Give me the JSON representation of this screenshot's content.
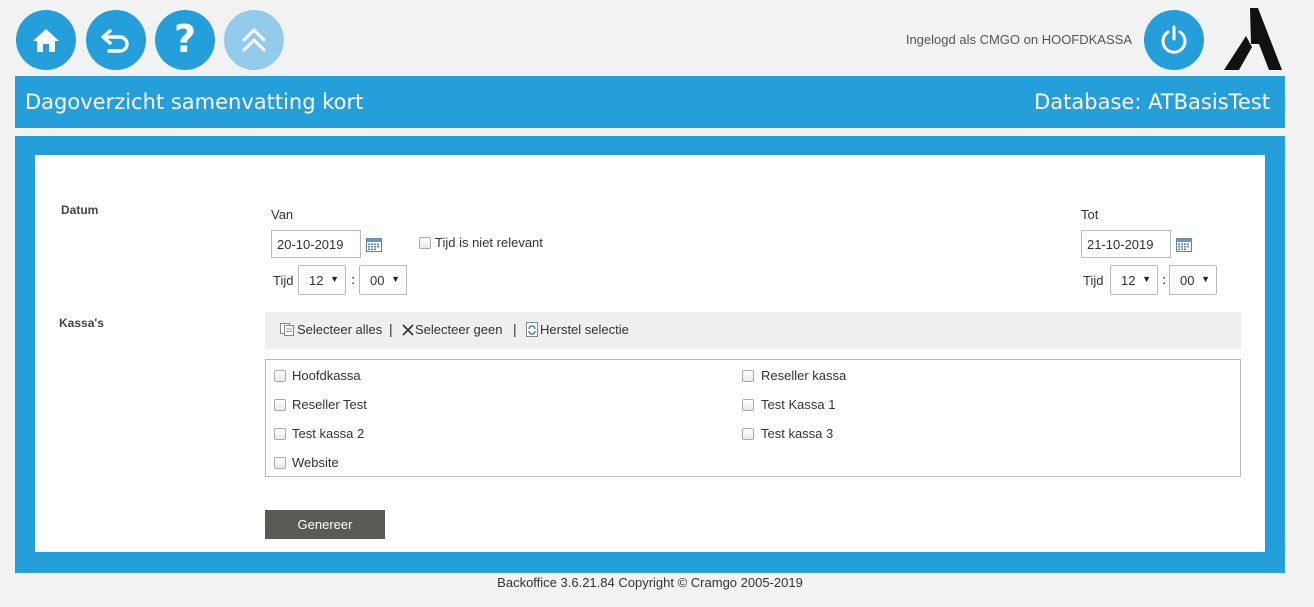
{
  "header": {
    "login_text": "Ingelogd als CMGO on HOOFDKASSA",
    "icons": {
      "home": "home-icon",
      "back": "back-arrow-icon",
      "help": "question-mark-icon",
      "up": "double-chevron-up-icon",
      "power": "power-icon",
      "logo": "a-logo-icon"
    },
    "help_glyph": "?"
  },
  "title_bar": {
    "title": "Dagoverzicht samenvatting kort",
    "database": "Database: ATBasisTest"
  },
  "form": {
    "datum_label": "Datum",
    "van_label": "Van",
    "van_date": "20-10-2019",
    "tot_label": "Tot",
    "tot_date": "21-10-2019",
    "tijd_not_relevant_label": "Tijd is niet relevant",
    "tijd_label": "Tijd",
    "van_hour": "12",
    "van_minute": "00",
    "tot_hour": "12",
    "tot_minute": "00",
    "colon": ":",
    "kassas_label": "Kassa's",
    "toolbar": {
      "select_all": "Selecteer alles",
      "select_none": "Selecteer geen",
      "restore": "Herstel selectie",
      "separator": "|"
    },
    "kassas": [
      "Hoofdkassa",
      "Reseller kassa",
      "Reseller Test",
      "Test Kassa 1",
      "Test kassa 2",
      "Test kassa 3",
      "Website"
    ],
    "generate_label": "Genereer"
  },
  "footer": {
    "text": "Backoffice 3.6.21.84 Copyright © Cramgo 2005-2019"
  },
  "colors": {
    "accent": "#259fd9",
    "accent_disabled": "#93cceb",
    "button_dark": "#5a5954"
  }
}
